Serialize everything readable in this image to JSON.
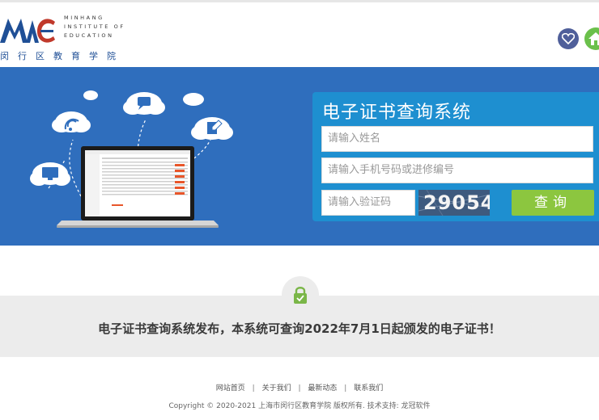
{
  "header": {
    "logo_en_lines": [
      "MINHANG",
      "INSTITUTE OF",
      "EDUCATION"
    ],
    "logo_cn": "闵行区教育学院",
    "favorite_icon": "heart-icon",
    "home_icon": "home-icon"
  },
  "panel": {
    "title": "电子证书查询系统",
    "name_placeholder": "请输入姓名",
    "phone_placeholder": "请输入手机号码或进修编号",
    "code_placeholder": "请输入验证码",
    "captcha": "29054",
    "query_label": "查询"
  },
  "notice": {
    "text": "电子证书查询系统发布，本系统可查询2022年7月1日起颁发的电子证书！"
  },
  "footer": {
    "links": [
      "网站首页",
      "关于我们",
      "最新动态",
      "联系我们"
    ],
    "copyright": "Copyright © 2020-2021 上海市闵行区教育学院 版权所有. 技术支持: 龙冠软件"
  },
  "colors": {
    "hero_bg": "#2f6ebd",
    "panel_bg": "#1e8fd0",
    "query_button": "#8cc63f",
    "band_bg": "#ececec"
  }
}
